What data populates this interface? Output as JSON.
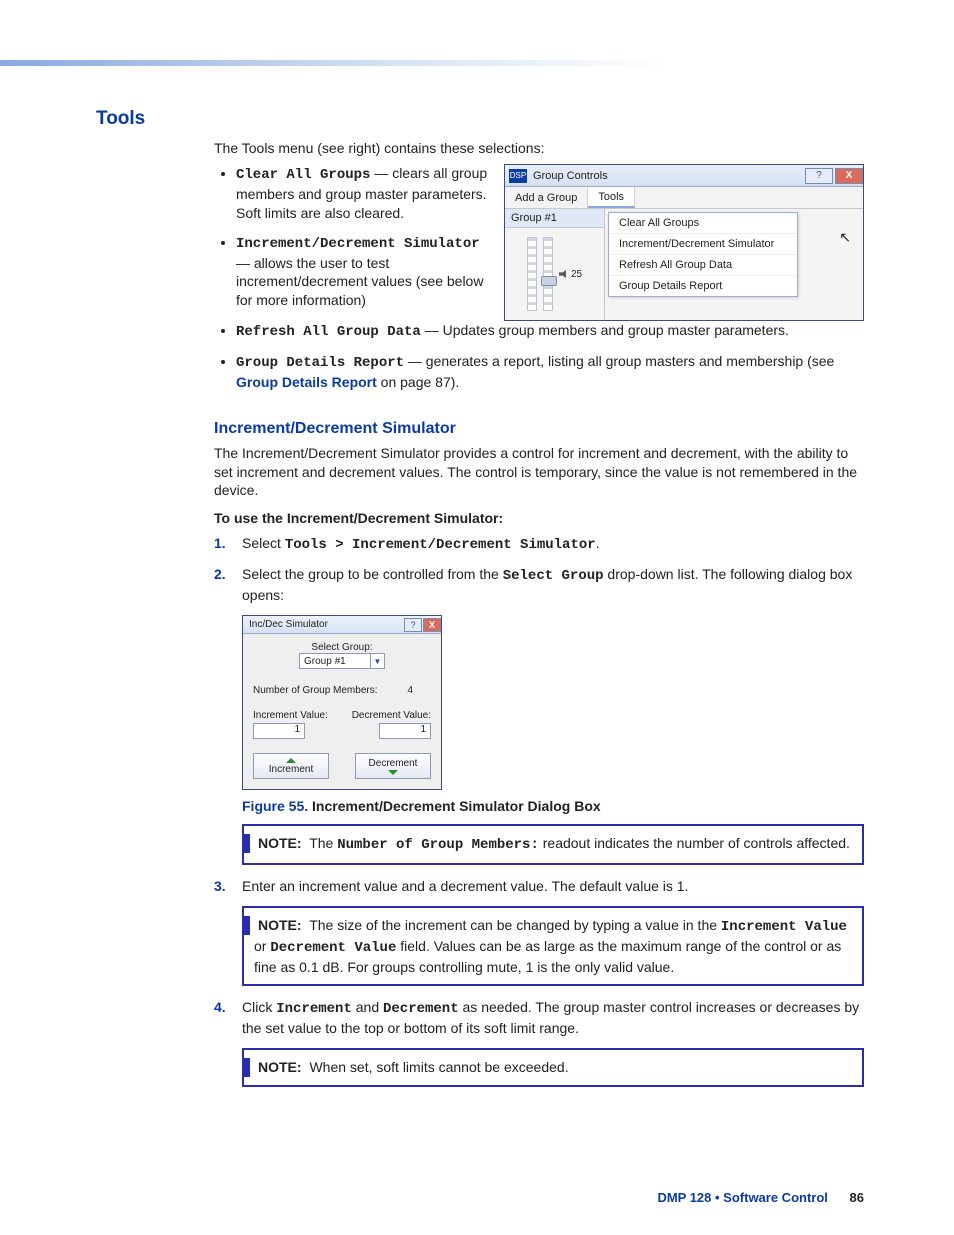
{
  "heading": "Tools",
  "intro": "The Tools menu (see right) contains these selections:",
  "bullets": {
    "b1_name": "Clear All Groups",
    "b1_text": " — clears all group members and group master parameters. Soft limits are also cleared.",
    "b2_name": "Increment/Decrement Simulator",
    "b2_text": " — allows the user to test increment/decrement values (see below for more information)",
    "b3_name": "Refresh All Group Data",
    "b3_text": " — Updates group members and group master parameters.",
    "b4_name": "Group Details Report",
    "b4_text_a": " — generates a report, listing all group masters and membership (see ",
    "b4_link": "Group Details Report",
    "b4_text_b": " on page 87)."
  },
  "gc": {
    "apptag": "DSP",
    "title": "Group Controls",
    "help": "?",
    "close": "X",
    "tab_add": "Add a Group",
    "tab_tools": "Tools",
    "group_label": "Group #1",
    "slider_value": "25",
    "menu": {
      "m1": "Clear All Groups",
      "m2": "Increment/Decrement Simulator",
      "m3": "Refresh All Group Data",
      "m4": "Group Details Report"
    }
  },
  "subhead": "Increment/Decrement Simulator",
  "subpara": "The Increment/Decrement Simulator provides a control for increment and decrement, with the ability to set increment and decrement values. The control is temporary, since the value is not remembered in the device.",
  "howto_lead": "To use the Increment/Decrement Simulator:",
  "steps": {
    "s1_a": "Select ",
    "s1_b": "Tools > Increment/Decrement Simulator",
    "s1_c": ".",
    "s2_a": "Select the group to be controlled from the ",
    "s2_b": "Select Group",
    "s2_c": " drop-down list. The following dialog box opens:",
    "s3": "Enter an increment value and a decrement value. The default value is 1.",
    "s4_a": "Click ",
    "s4_b": "Increment",
    "s4_c": " and ",
    "s4_d": "Decrement",
    "s4_e": " as needed. The group master control increases or decreases by the set value to the top or bottom of its soft limit range."
  },
  "sim": {
    "title": "Inc/Dec Simulator",
    "help": "?",
    "close": "X",
    "select_label": "Select Group:",
    "select_value": "Group #1",
    "members_label": "Number of Group Members:",
    "members_value": "4",
    "inc_label": "Increment Value:",
    "inc_value": "1",
    "dec_label": "Decrement Value:",
    "dec_value": "1",
    "inc_btn": "Increment",
    "dec_btn": "Decrement"
  },
  "fig": {
    "num": "Figure 55.",
    "cap": " Increment/Decrement Simulator Dialog Box"
  },
  "notes": {
    "label": "NOTE:",
    "n1_a": " The ",
    "n1_b": "Number of Group Members:",
    "n1_c": " readout indicates the number of controls affected.",
    "n2_a": " The size of the increment can be changed by typing a value in the ",
    "n2_b": "Increment Value",
    "n2_c": " or ",
    "n2_d": "Decrement Value",
    "n2_e": " field. Values can be as large as the maximum range of the control or as fine as 0.1 dB. For groups controlling mute, 1 is the only valid value.",
    "n3": " When set, soft limits cannot be exceeded."
  },
  "footer": {
    "text": "DMP 128 • Software Control",
    "page": "86"
  }
}
